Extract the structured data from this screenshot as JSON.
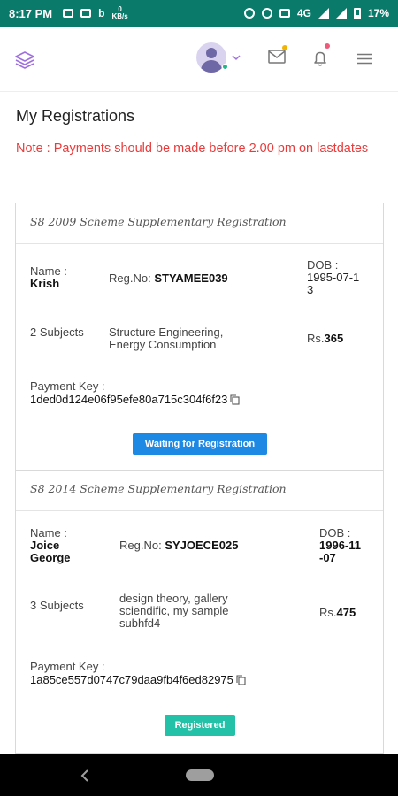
{
  "status_bar": {
    "time": "8:17 PM",
    "network": "4G",
    "battery": "17%",
    "kbs": "0\nKB/s"
  },
  "header": {
    "icons": [
      "layers-icon",
      "avatar",
      "chevron-down-icon",
      "mail-icon",
      "bell-icon",
      "menu-icon"
    ],
    "accent": "#a070e0"
  },
  "page": {
    "title": "My Registrations",
    "note": "Note : Payments should be made before 2.00 pm on lastdates"
  },
  "registrations": [
    {
      "scheme": "S8 2009 Scheme Supplementary Registration",
      "name_label": "Name :",
      "name": "Krish",
      "reg_label": "Reg.No:",
      "reg_no": "STYAMEE039",
      "dob_label": "DOB :",
      "dob": "1995-07-13",
      "subjects_count": "2 Subjects",
      "subjects": "Structure Engineering, Energy Consumption",
      "amount_label": "Rs.",
      "amount": "365",
      "payment_key_label": "Payment Key :",
      "payment_key": "1ded0d124e06f95efe80a715c304f6f23",
      "status": "Waiting for Registration",
      "status_color": "#1e88e5"
    },
    {
      "scheme": "S8 2014 Scheme Supplementary Registration",
      "name_label": "Name :",
      "name": "Joice George",
      "reg_label": "Reg.No:",
      "reg_no": "SYJOECE025",
      "dob_label": "DOB :",
      "dob": "1996-11-07",
      "subjects_count": "3 Subjects",
      "subjects": "design theory, gallery sciendific, my sample subhfd4",
      "amount_label": "Rs.",
      "amount": "475",
      "payment_key_label": "Payment Key :",
      "payment_key": "1a85ce557d0747c79daa9fb4f6ed82975",
      "status": "Registered",
      "status_color": "#23c1a8"
    }
  ]
}
